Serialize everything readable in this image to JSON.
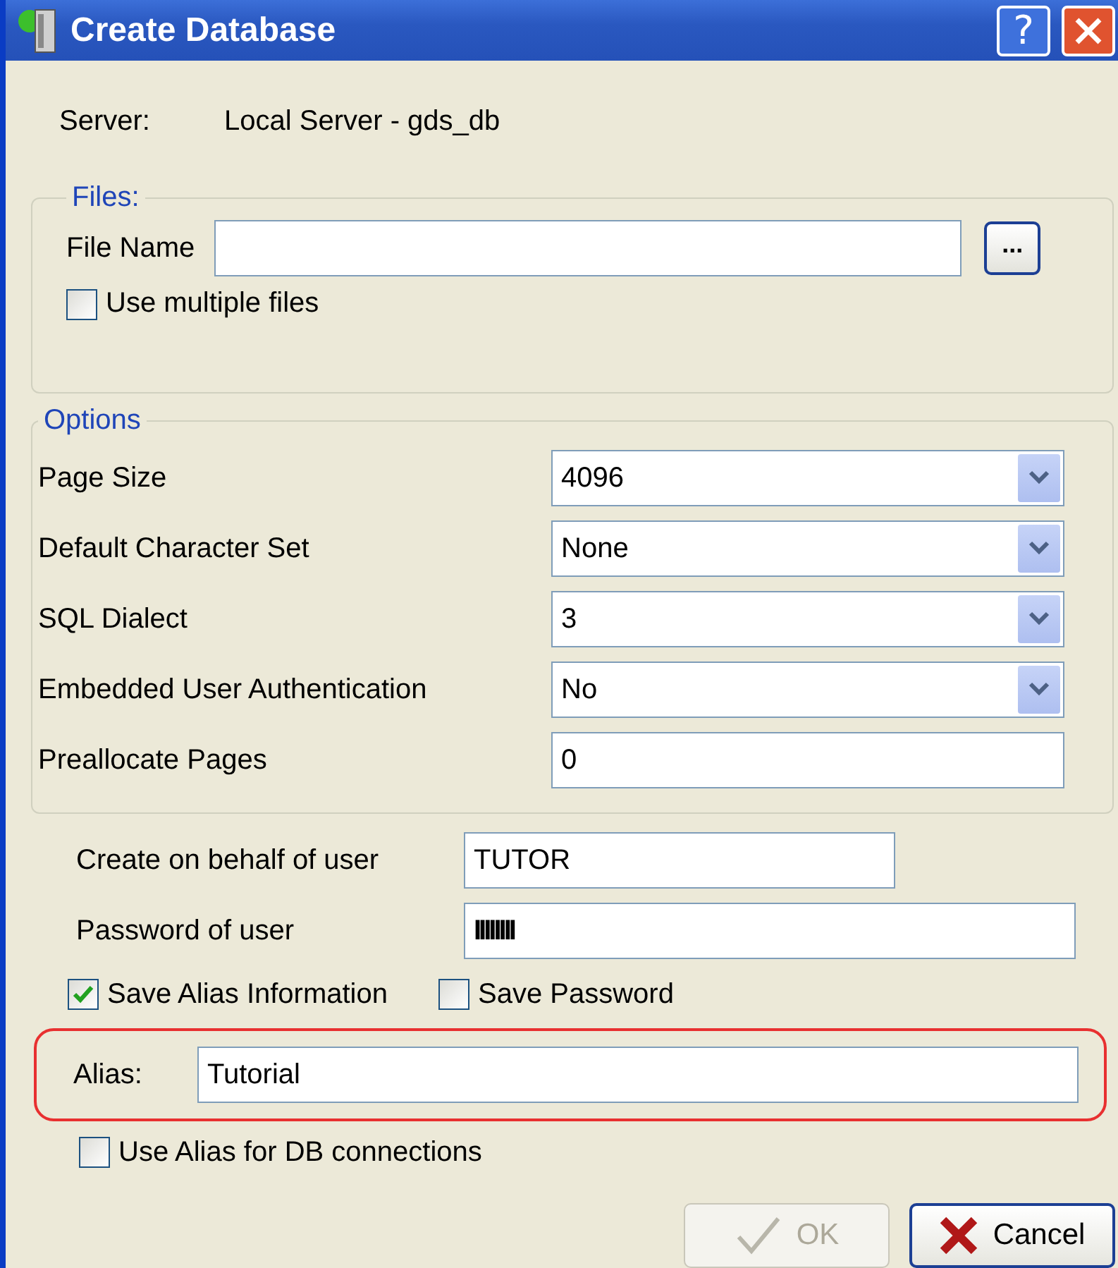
{
  "window": {
    "title": "Create Database",
    "help_button": "?"
  },
  "server": {
    "label": "Server:",
    "value": "Local Server - gds_db"
  },
  "files": {
    "title": "Files:",
    "file_name_label": "File Name",
    "browse_button": "...",
    "multiple_files": {
      "label": "Use multiple files",
      "checked": false
    }
  },
  "options": {
    "title": "Options",
    "rows": [
      {
        "label": "Page Size",
        "kind": "dropdown",
        "value": "4096"
      },
      {
        "label": "Default Character Set",
        "kind": "dropdown",
        "value": "None"
      },
      {
        "label": "SQL Dialect",
        "kind": "dropdown",
        "value": "3"
      },
      {
        "label": "Embedded User Authentication",
        "kind": "dropdown",
        "value": "No"
      },
      {
        "label": "Preallocate Pages",
        "kind": "text",
        "value": "0"
      }
    ]
  },
  "user_fields": [
    {
      "label": "Create on behalf of user",
      "kind": "short",
      "value": "TUTOR"
    },
    {
      "label": "Password of user",
      "kind": "long",
      "value": "IIIIIIII"
    }
  ],
  "checkboxes": [
    {
      "label": "Save Alias Information",
      "checked": true
    },
    {
      "label": "Save Password",
      "checked": false
    }
  ],
  "alias": {
    "label": "Alias:",
    "value": "Tutorial",
    "highlighted": true
  },
  "use_alias": {
    "label": "Use Alias for DB connections",
    "checked": false
  },
  "buttons": [
    {
      "label": "OK",
      "kind": "ok",
      "disabled": true
    },
    {
      "label": "Cancel",
      "kind": "cancel",
      "disabled": false
    }
  ]
}
